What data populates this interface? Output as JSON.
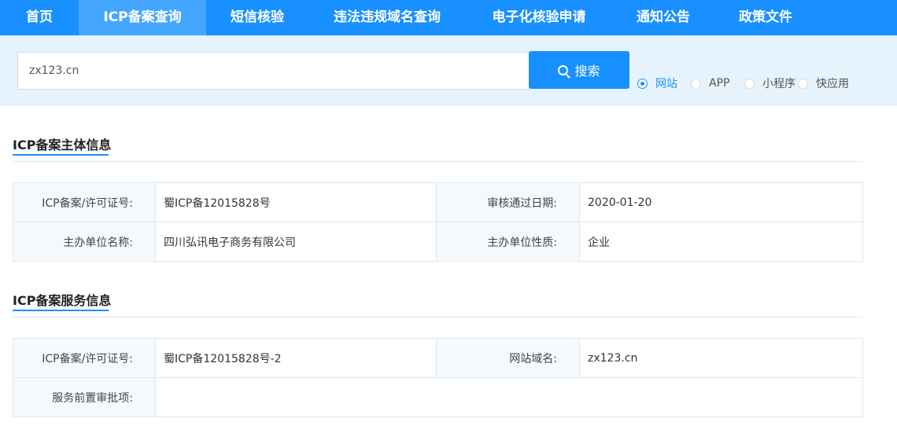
{
  "nav": {
    "items": [
      {
        "label": "首页"
      },
      {
        "label": "ICP备案查询"
      },
      {
        "label": "短信核验"
      },
      {
        "label": "违法违规域名查询"
      },
      {
        "label": "电子化核验申请"
      },
      {
        "label": "通知公告"
      },
      {
        "label": "政策文件"
      }
    ],
    "active_index": 1
  },
  "search": {
    "value": "zx123.cn",
    "button_label": "搜索",
    "button_icon": "search-icon",
    "types": [
      {
        "label": "网站",
        "checked": true
      },
      {
        "label": "APP",
        "checked": false
      },
      {
        "label": "小程序",
        "checked": false
      },
      {
        "label": "快应用",
        "checked": false
      }
    ]
  },
  "subject_info": {
    "title": "ICP备案主体信息",
    "rows": [
      {
        "label1": "ICP备案/许可证号:",
        "value1": "蜀ICP备12015828号",
        "label2": "审核通过日期:",
        "value2": "2020-01-20"
      },
      {
        "label1": "主办单位名称:",
        "value1": "四川弘讯电子商务有限公司",
        "label2": "主办单位性质:",
        "value2": "企业"
      }
    ]
  },
  "service_info": {
    "title": "ICP备案服务信息",
    "rows": [
      {
        "label1": "ICP备案/许可证号:",
        "value1": "蜀ICP备12015828号-2",
        "label2": "网站域名:",
        "value2": "zx123.cn"
      },
      {
        "label1": "服务前置审批项:",
        "value1": ""
      }
    ]
  },
  "colors": {
    "primary": "#1890ff",
    "nav_active": "#45a6ff",
    "search_band": "#e6f3fd",
    "label_cell": "#f4f9fd"
  }
}
